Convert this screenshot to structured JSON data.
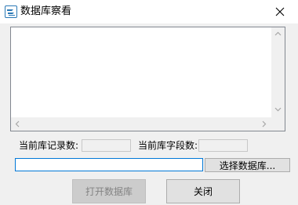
{
  "window": {
    "title": "数据库察看"
  },
  "stats": {
    "record_count_label": "当前库记录数:",
    "record_count_value": "",
    "field_count_label": "当前库字段数:",
    "field_count_value": ""
  },
  "path": {
    "value": ""
  },
  "buttons": {
    "select_db": "选择数据库...",
    "open_db": "打开数据库",
    "close": "关闭"
  },
  "icons": {
    "app": "database-app-icon",
    "close": "close-icon",
    "scroll_up": "chevron-up-icon",
    "scroll_down": "chevron-down-icon",
    "scroll_left": "chevron-left-icon",
    "scroll_right": "chevron-right-icon"
  },
  "colors": {
    "accent": "#0078d7",
    "window_bg": "#f0f0f0"
  }
}
